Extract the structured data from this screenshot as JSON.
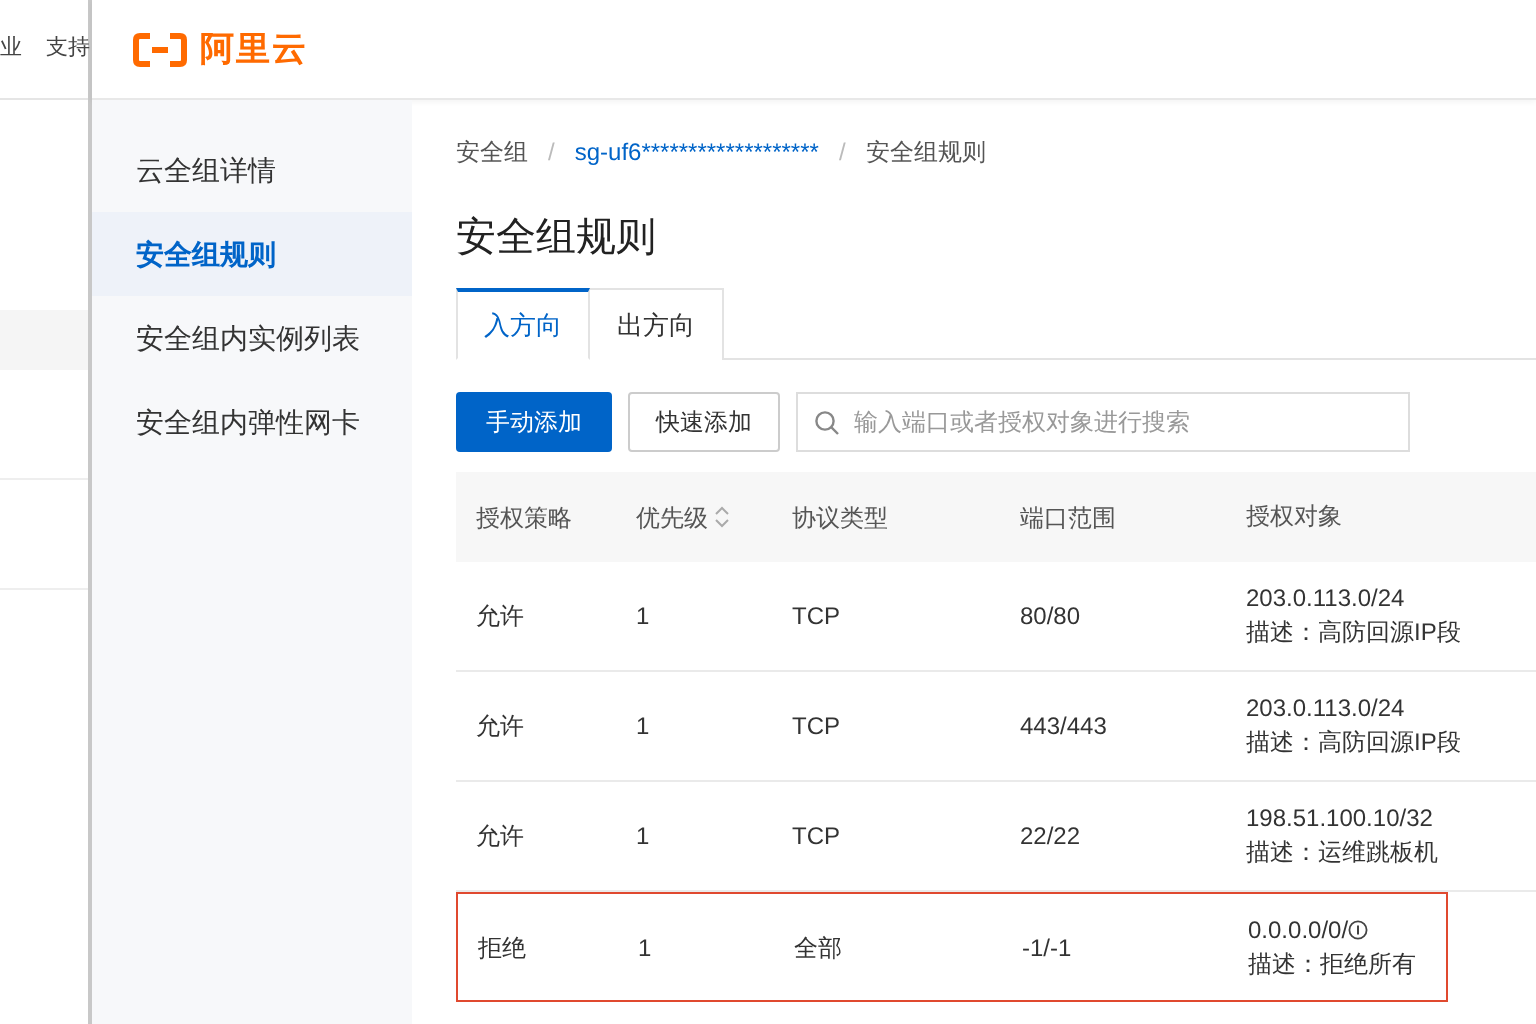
{
  "background_page": {
    "nav_items": [
      "业",
      "支持"
    ]
  },
  "logo": {
    "text": "阿里云"
  },
  "sidebar": {
    "items": [
      {
        "label": "云全组详情",
        "selected": false
      },
      {
        "label": "安全组规则",
        "selected": true
      },
      {
        "label": "安全组内实例列表",
        "selected": false
      },
      {
        "label": "安全组内弹性网卡",
        "selected": false
      }
    ]
  },
  "breadcrumb": {
    "separator": "/",
    "items": [
      {
        "label": "安全组",
        "kind": "text"
      },
      {
        "label": "sg-uf6*******************",
        "kind": "link"
      },
      {
        "label": "安全组规则",
        "kind": "text"
      }
    ]
  },
  "page_title": "安全组规则",
  "tabs": [
    {
      "label": "入方向",
      "selected": true
    },
    {
      "label": "出方向",
      "selected": false
    }
  ],
  "toolbar": {
    "buttons": [
      {
        "label": "手动添加",
        "kind": "primary"
      },
      {
        "label": "快速添加",
        "kind": "secondary"
      }
    ],
    "search": {
      "placeholder": "输入端口或者授权对象进行搜索"
    }
  },
  "table": {
    "columns": [
      {
        "label": "授权策略",
        "sortable": false
      },
      {
        "label": "优先级",
        "sortable": true
      },
      {
        "label": "协议类型",
        "sortable": false
      },
      {
        "label": "端口范围",
        "sortable": false
      },
      {
        "label": "授权对象",
        "sortable": false
      }
    ],
    "rows": [
      {
        "policy": "允许",
        "priority": "1",
        "protocol": "TCP",
        "port": "80/80",
        "target": "203.0.113.0/24",
        "info_icon": false,
        "description": "描述：高防回源IP段",
        "highlighted": false
      },
      {
        "policy": "允许",
        "priority": "1",
        "protocol": "TCP",
        "port": "443/443",
        "target": "203.0.113.0/24",
        "info_icon": false,
        "description": "描述：高防回源IP段",
        "highlighted": false
      },
      {
        "policy": "允许",
        "priority": "1",
        "protocol": "TCP",
        "port": "22/22",
        "target": "198.51.100.10/32",
        "info_icon": false,
        "description": "描述：运维跳板机",
        "highlighted": false
      },
      {
        "policy": "拒绝",
        "priority": "1",
        "protocol": "全部",
        "port": "-1/-1",
        "target": "0.0.0.0/0/",
        "info_icon": true,
        "description": "描述：拒绝所有",
        "highlighted": true
      }
    ]
  }
}
